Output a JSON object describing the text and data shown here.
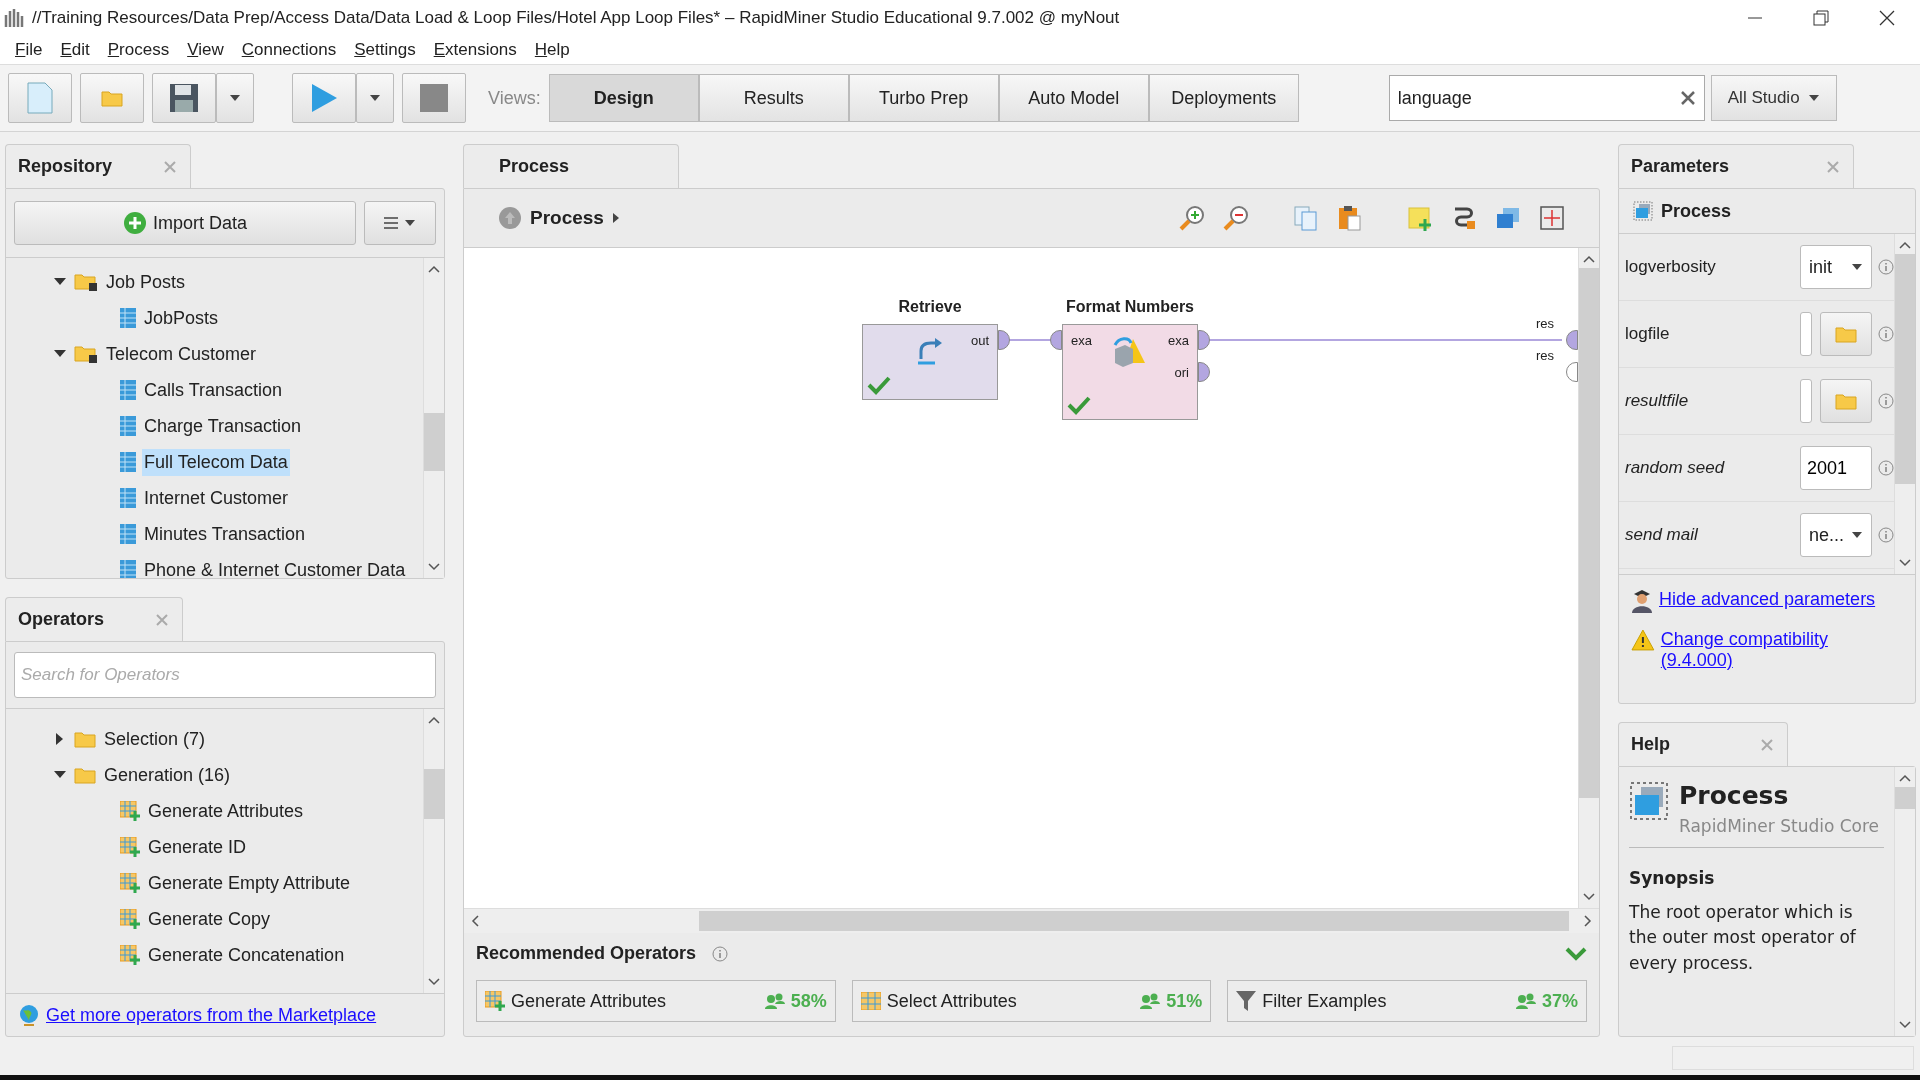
{
  "window": {
    "title": "//Training Resources/Data Prep/Access Data/Data Load & Loop Files/Hotel App Loop Files* – RapidMiner Studio Educational 9.7.002 @ myNout"
  },
  "menu": [
    "File",
    "Edit",
    "Process",
    "View",
    "Connections",
    "Settings",
    "Extensions",
    "Help"
  ],
  "toolbar": {
    "views_label": "Views:",
    "views": [
      {
        "label": "Design",
        "selected": true
      },
      {
        "label": "Results",
        "selected": false
      },
      {
        "label": "Turbo Prep",
        "selected": false
      },
      {
        "label": "Auto Model",
        "selected": false
      },
      {
        "label": "Deployments",
        "selected": false
      }
    ],
    "search": {
      "value": "language"
    },
    "scope": "All Studio"
  },
  "repository": {
    "title": "Repository",
    "import_button": "Import Data",
    "tree": [
      {
        "label": "Job Posts",
        "kind": "folder",
        "expanded": true,
        "selected": false,
        "children": [
          {
            "label": "JobPosts",
            "kind": "data",
            "selected": false
          }
        ]
      },
      {
        "label": "Telecom Customer",
        "kind": "folder",
        "expanded": true,
        "selected": false,
        "children": [
          {
            "label": "Calls Transaction",
            "kind": "data",
            "selected": false
          },
          {
            "label": "Charge Transaction",
            "kind": "data",
            "selected": false
          },
          {
            "label": "Full Telecom Data",
            "kind": "data",
            "selected": true
          },
          {
            "label": "Internet Customer",
            "kind": "data",
            "selected": false
          },
          {
            "label": "Minutes Transaction",
            "kind": "data",
            "selected": false
          },
          {
            "label": "Phone & Internet Customer Data",
            "kind": "data",
            "selected": false
          }
        ]
      }
    ]
  },
  "operators": {
    "title": "Operators",
    "search": {
      "placeholder": "Search for Operators"
    },
    "tree": [
      {
        "label": "Selection (7)",
        "kind": "folder",
        "expanded": false,
        "selected": false
      },
      {
        "label": "Generation (16)",
        "kind": "folder",
        "expanded": true,
        "selected": false,
        "children": [
          {
            "label": "Generate Attributes",
            "kind": "operator",
            "selected": false
          },
          {
            "label": "Generate ID",
            "kind": "operator",
            "selected": false
          },
          {
            "label": "Generate Empty Attribute",
            "kind": "operator",
            "selected": false
          },
          {
            "label": "Generate Copy",
            "kind": "operator",
            "selected": false
          },
          {
            "label": "Generate Concatenation",
            "kind": "operator",
            "selected": false
          }
        ]
      }
    ],
    "marketplace_link": "Get more operators from the Marketplace"
  },
  "process": {
    "tab": "Process",
    "breadcrumb": "Process",
    "nodes": [
      {
        "name": "Retrieve",
        "kind": "retrieve",
        "color": "#e1dcec",
        "valid": true,
        "outputs": [
          {
            "label": "out",
            "active": true
          }
        ]
      },
      {
        "name": "Format Numbers",
        "kind": "format",
        "color": "#f2dbe6",
        "valid": true,
        "inputs": [
          {
            "label": "exa",
            "active": true
          }
        ],
        "outputs": [
          {
            "label": "exa",
            "active": true
          },
          {
            "label": "ori",
            "active": true
          }
        ]
      }
    ],
    "result_ports": [
      {
        "label": "res",
        "active": true
      },
      {
        "label": "res",
        "active": false
      }
    ]
  },
  "recommended": {
    "title": "Recommended Operators",
    "items": [
      {
        "label": "Generate Attributes",
        "kind": "generate",
        "share": "58%"
      },
      {
        "label": "Select Attributes",
        "kind": "select",
        "share": "51%"
      },
      {
        "label": "Filter Examples",
        "kind": "filter",
        "share": "37%"
      }
    ]
  },
  "parameters": {
    "title": "Parameters",
    "operator": "Process",
    "rows": [
      {
        "label": "logverbosity",
        "kind": "select",
        "value": "init",
        "advanced": false
      },
      {
        "label": "logfile",
        "kind": "file",
        "advanced": false
      },
      {
        "label": "resultfile",
        "kind": "file",
        "advanced": true
      },
      {
        "label": "random seed",
        "kind": "text",
        "value": "2001",
        "advanced": true
      },
      {
        "label": "send mail",
        "kind": "select",
        "value": "ne...",
        "advanced": true
      }
    ],
    "links": [
      {
        "label": "Hide advanced parameters",
        "kind": "advanced"
      },
      {
        "label": "Change compatibility (9.4.000)",
        "kind": "warning"
      }
    ]
  },
  "help": {
    "title": "Help",
    "operator": "Process",
    "subtitle": "RapidMiner Studio Core",
    "synopsis_title": "Synopsis",
    "synopsis": "The root operator which is the outer most operator of every process."
  }
}
